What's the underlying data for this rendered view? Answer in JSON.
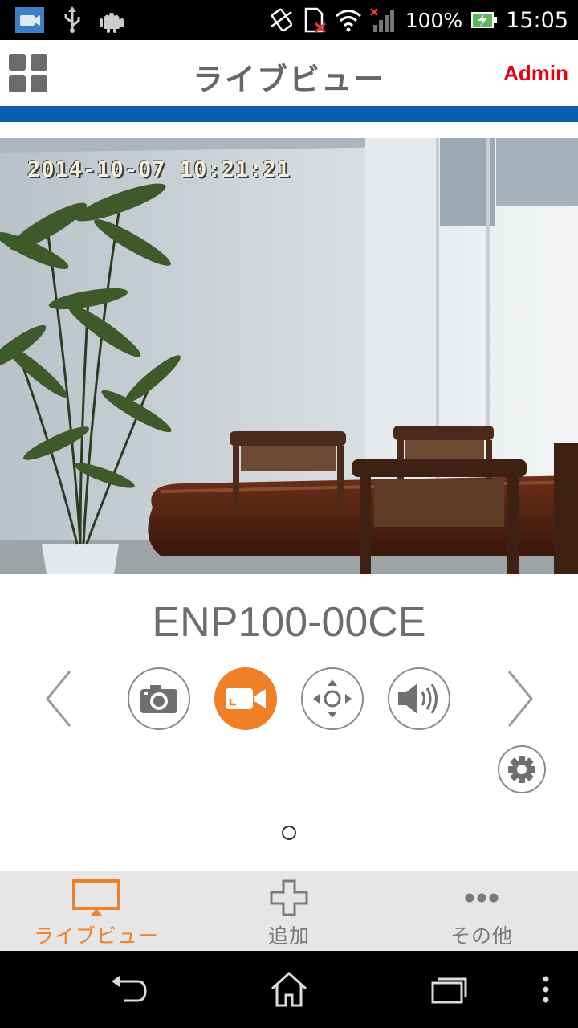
{
  "status_bar": {
    "battery_percent": "100%",
    "time": "15:05"
  },
  "header": {
    "title": "ライブビュー",
    "user": "Admin",
    "accent_blue": "#0a5fb0",
    "user_color": "#e60012"
  },
  "camera": {
    "timestamp": "2014-10-07 10:21:21",
    "name": "ENP100-00CE"
  },
  "controls": {
    "items": [
      "camera-icon",
      "video-record-icon",
      "pan-tilt-icon",
      "speaker-icon"
    ],
    "active_color": "#f07f26",
    "page_count": 1
  },
  "tabs": [
    {
      "label": "ライブビュー",
      "icon": "monitor-icon",
      "active": true
    },
    {
      "label": "追加",
      "icon": "plus-icon",
      "active": false
    },
    {
      "label": "その他",
      "icon": "more-icon",
      "active": false
    }
  ]
}
